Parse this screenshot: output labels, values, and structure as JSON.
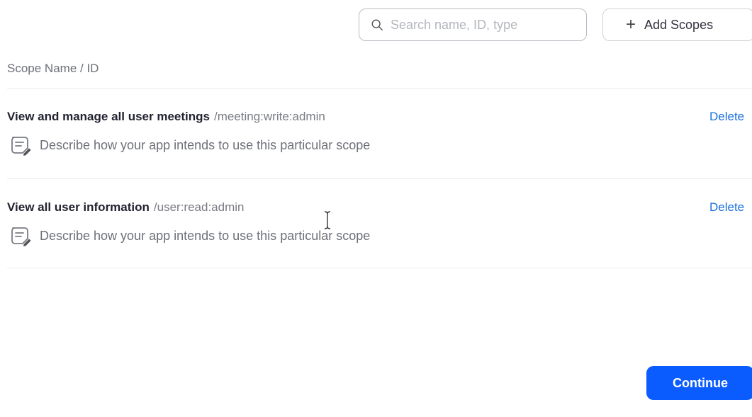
{
  "toolbar": {
    "search_placeholder": "Search name, ID, type",
    "add_scopes_label": "Add Scopes"
  },
  "table": {
    "header": "Scope Name / ID",
    "rows": [
      {
        "name": "View and manage all user meetings",
        "id": "/meeting:write:admin",
        "delete_label": "Delete",
        "description_placeholder": "Describe how your app intends to use this particular scope"
      },
      {
        "name": "View all user information",
        "id": "/user:read:admin",
        "delete_label": "Delete",
        "description_placeholder": "Describe how your app intends to use this particular scope"
      }
    ]
  },
  "footer": {
    "continue_label": "Continue"
  },
  "colors": {
    "primary": "#0b5cff",
    "link": "#1a6fe0",
    "muted_text": "#6e7078",
    "border": "#b9bcc4"
  },
  "icons": {
    "search": "search-icon",
    "add": "plus-icon",
    "edit_note": "edit-note-icon",
    "cursor": "text-cursor-icon"
  }
}
